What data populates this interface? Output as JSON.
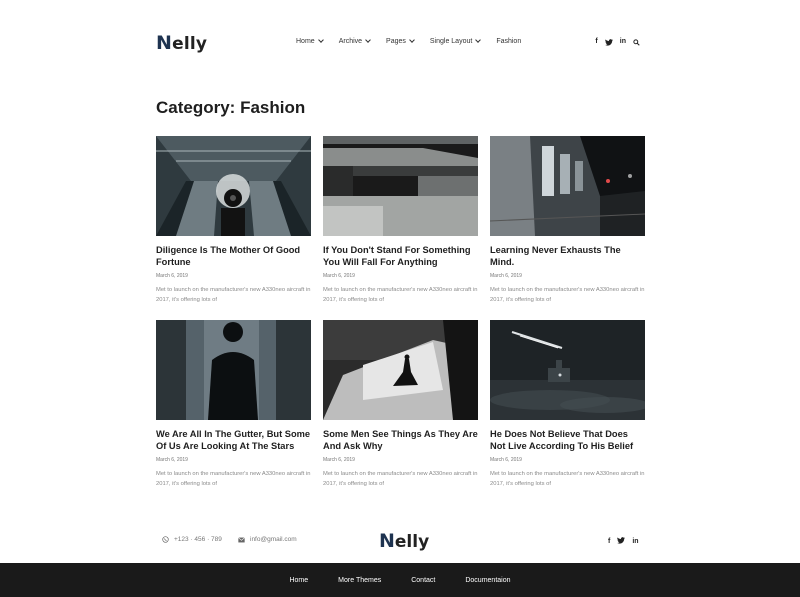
{
  "header": {
    "logo": "Nelly",
    "nav": [
      {
        "label": "Home",
        "dropdown": true
      },
      {
        "label": "Archive",
        "dropdown": true
      },
      {
        "label": "Pages",
        "dropdown": true
      },
      {
        "label": "Single Layout",
        "dropdown": true
      },
      {
        "label": "Fashion",
        "dropdown": false
      }
    ],
    "social": {
      "facebook": "f",
      "linkedin": "in"
    }
  },
  "page": {
    "title": "Category: Fashion"
  },
  "posts": [
    {
      "title": "Diligence Is The Mother Of Good Fortune",
      "date": "March 6, 2019",
      "excerpt": "Met to launch on the manufacturer's new A330neo aircraft in 2017, it's offering lots of"
    },
    {
      "title": "If You Don't Stand For Something You Will Fall For Anything",
      "date": "March 6, 2019",
      "excerpt": "Met to launch on the manufacturer's new A330neo aircraft in 2017, it's offering lots of"
    },
    {
      "title": "Learning Never Exhausts The Mind.",
      "date": "March 6, 2019",
      "excerpt": "Met to launch on the manufacturer's new A330neo aircraft in 2017, it's offering lots of"
    },
    {
      "title": "We Are All In The Gutter, But Some Of Us Are Looking At The Stars",
      "date": "March 6, 2019",
      "excerpt": "Met to launch on the manufacturer's new A330neo aircraft in 2017, it's offering lots of"
    },
    {
      "title": "Some Men See Things As They Are And Ask Why",
      "date": "March 6, 2019",
      "excerpt": "Met to launch on the manufacturer's new A330neo aircraft in 2017, it's offering lots of"
    },
    {
      "title": "He Does Not Believe That Does Not Live According To His Belief",
      "date": "March 6, 2019",
      "excerpt": "Met to launch on the manufacturer's new A330neo aircraft in 2017, it's offering lots of"
    }
  ],
  "footer": {
    "phone": "+123 · 456 · 789",
    "email": "info@gmail.com",
    "logo": "Nelly",
    "links": [
      "Home",
      "More Themes",
      "Contact",
      "Documentaion"
    ]
  },
  "colors": {
    "accent": "#1e3350",
    "footer_bg": "#1a1a1a"
  }
}
